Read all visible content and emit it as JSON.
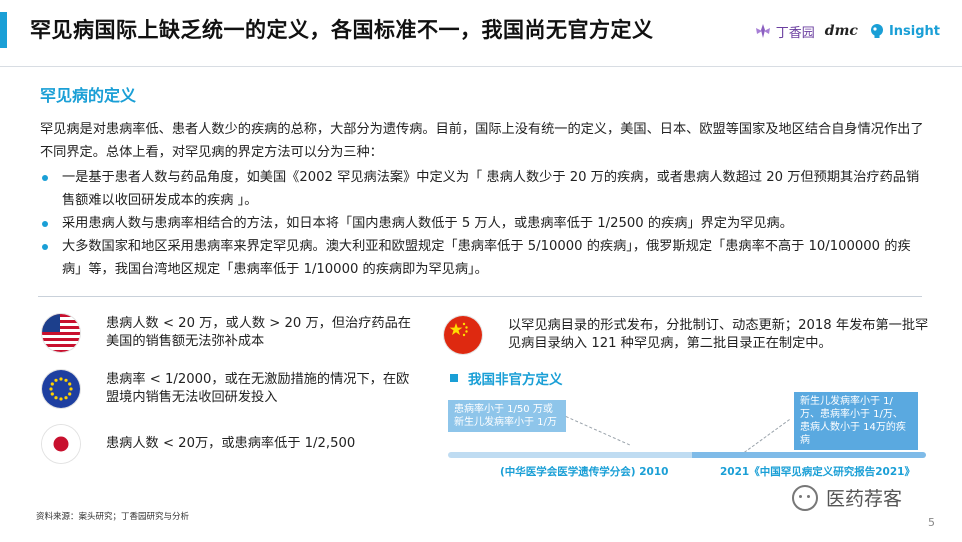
{
  "header": {
    "title": "罕见病国际上缺乏统一的定义，各国标准不一，我国尚无官方定义",
    "logos": {
      "dxy": "丁香园",
      "amc": "dmc",
      "insight": "Insight"
    }
  },
  "section": {
    "heading": "罕见病的定义",
    "intro": "罕见病是对患病率低、患者人数少的疾病的总称，大部分为遗传病。目前，国际上没有统一的定义，美国、日本、欧盟等国家及地区结合自身情况作出了不同界定。总体上看，对罕见病的界定方法可以分为三种：",
    "bullets": [
      "一是基于患者人数与药品角度，如美国《2002 罕见病法案》中定义为「 患病人数少于 20 万的疾病，或者患病人数超过 20 万但预期其治疗药品销售额难以收回研发成本的疾病 」。",
      " 采用患病人数与患病率相结合的方法，如日本将「国内患病人数低于 5 万人，或患病率低于 1/2500 的疾病」界定为罕见病。",
      "大多数国家和地区采用患病率来界定罕见病。澳大利亚和欧盟规定「患病率低于 5/10000 的疾病」，俄罗斯规定「患病率不高于 10/100000 的疾病」等，我国台湾地区规定「患病率低于 1/10000 的疾病即为罕见病」。"
    ]
  },
  "definitions": {
    "usa": "患病人数 < 20 万，或人数 > 20 万，但治疗药品在美国的销售额无法弥补成本",
    "eu": "患病率 < 1/2000，或在无激励措施的情况下，在欧盟境内销售无法收回研发投入",
    "japan": "患病人数 < 20万，或患病率低于 1/2,500",
    "china": "以罕见病目录的形式发布，分批制订、动态更新；2018 年发布第一批罕见病目录纳入 121 种罕见病，第二批目录正在制定中。"
  },
  "unofficial": {
    "heading": "我国非官方定义",
    "box1": "患病率小于 1/50 万或新生儿发病率小于 1/万",
    "box2": "新生儿发病率小于 1/万、患病率小于 1/万、患病人数小于 14万的疾病",
    "year1": "(中华医学会医学遗传学分会) 2010",
    "year2": "2021《中国罕见病定义研究报告2021》"
  },
  "footer": {
    "source": "资料来源：案头研究；丁香园研究与分析",
    "watermark": "医药荐客",
    "page": "5"
  },
  "colors": {
    "accent": "#1a9fd6",
    "box_light": "#8ec5ea",
    "box_dark": "#5aa9e0"
  }
}
